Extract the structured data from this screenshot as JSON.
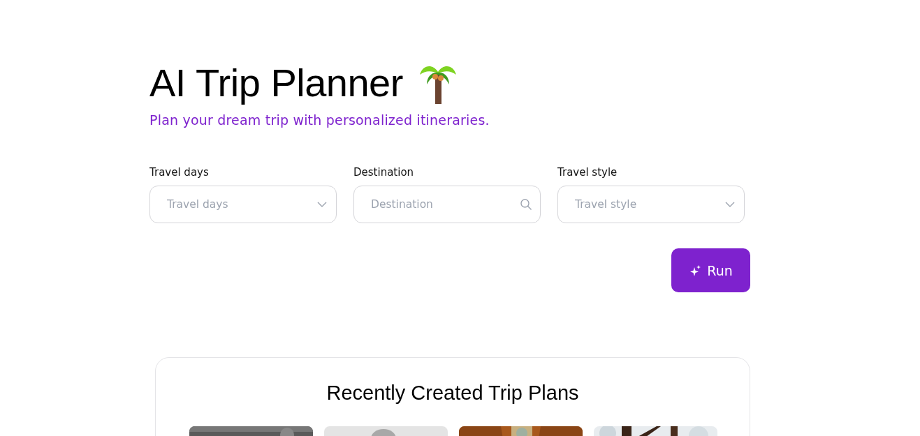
{
  "header": {
    "title": "AI Trip Planner",
    "subtitle": "Plan your dream trip with personalized itineraries."
  },
  "fields": [
    {
      "kind": "select",
      "label": "Travel days",
      "placeholder": "Travel days"
    },
    {
      "kind": "search",
      "label": "Destination",
      "placeholder": "Destination"
    },
    {
      "kind": "select",
      "label": "Travel style",
      "placeholder": "Travel style"
    }
  ],
  "run_button": {
    "label": "Run"
  },
  "recent": {
    "title": "Recently Created Trip Plans"
  }
}
